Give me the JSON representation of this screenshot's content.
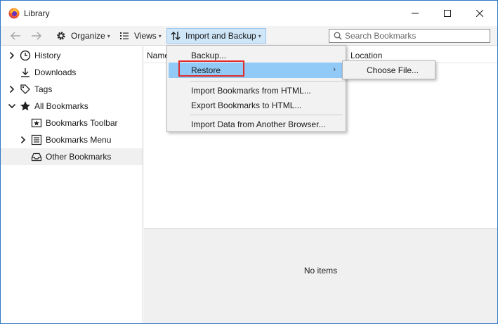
{
  "window": {
    "title": "Library",
    "accent": "#2e77c9"
  },
  "toolbar": {
    "organize_label": "Organize",
    "views_label": "Views",
    "import_backup_label": "Import and Backup",
    "search_placeholder": "Search Bookmarks"
  },
  "sidebar": {
    "items": [
      {
        "label": "History",
        "icon": "clock-icon",
        "twisty": "collapsed"
      },
      {
        "label": "Downloads",
        "icon": "download-icon",
        "twisty": "none"
      },
      {
        "label": "Tags",
        "icon": "tag-icon",
        "twisty": "collapsed"
      },
      {
        "label": "All Bookmarks",
        "icon": "star-icon",
        "twisty": "expanded"
      },
      {
        "label": "Bookmarks Toolbar",
        "icon": "bookmark-toolbar-icon",
        "twisty": "none"
      },
      {
        "label": "Bookmarks Menu",
        "icon": "bookmark-menu-icon",
        "twisty": "collapsed"
      },
      {
        "label": "Other Bookmarks",
        "icon": "tray-icon",
        "twisty": "none",
        "selected": true
      }
    ]
  },
  "content": {
    "columns": [
      "Name",
      "Location"
    ],
    "empty_text": "No items"
  },
  "import_menu": {
    "items": [
      {
        "label": "Backup..."
      },
      {
        "label": "Restore",
        "highlighted": true,
        "submenu": true
      },
      {
        "label": "Import Bookmarks from HTML..."
      },
      {
        "label": "Export Bookmarks to HTML..."
      },
      {
        "label": "Import Data from Another Browser..."
      }
    ],
    "highlight_color": "#91c9f7",
    "annotation_color": "#e02b2b"
  },
  "restore_submenu": {
    "items": [
      {
        "label": "Choose File..."
      }
    ]
  }
}
